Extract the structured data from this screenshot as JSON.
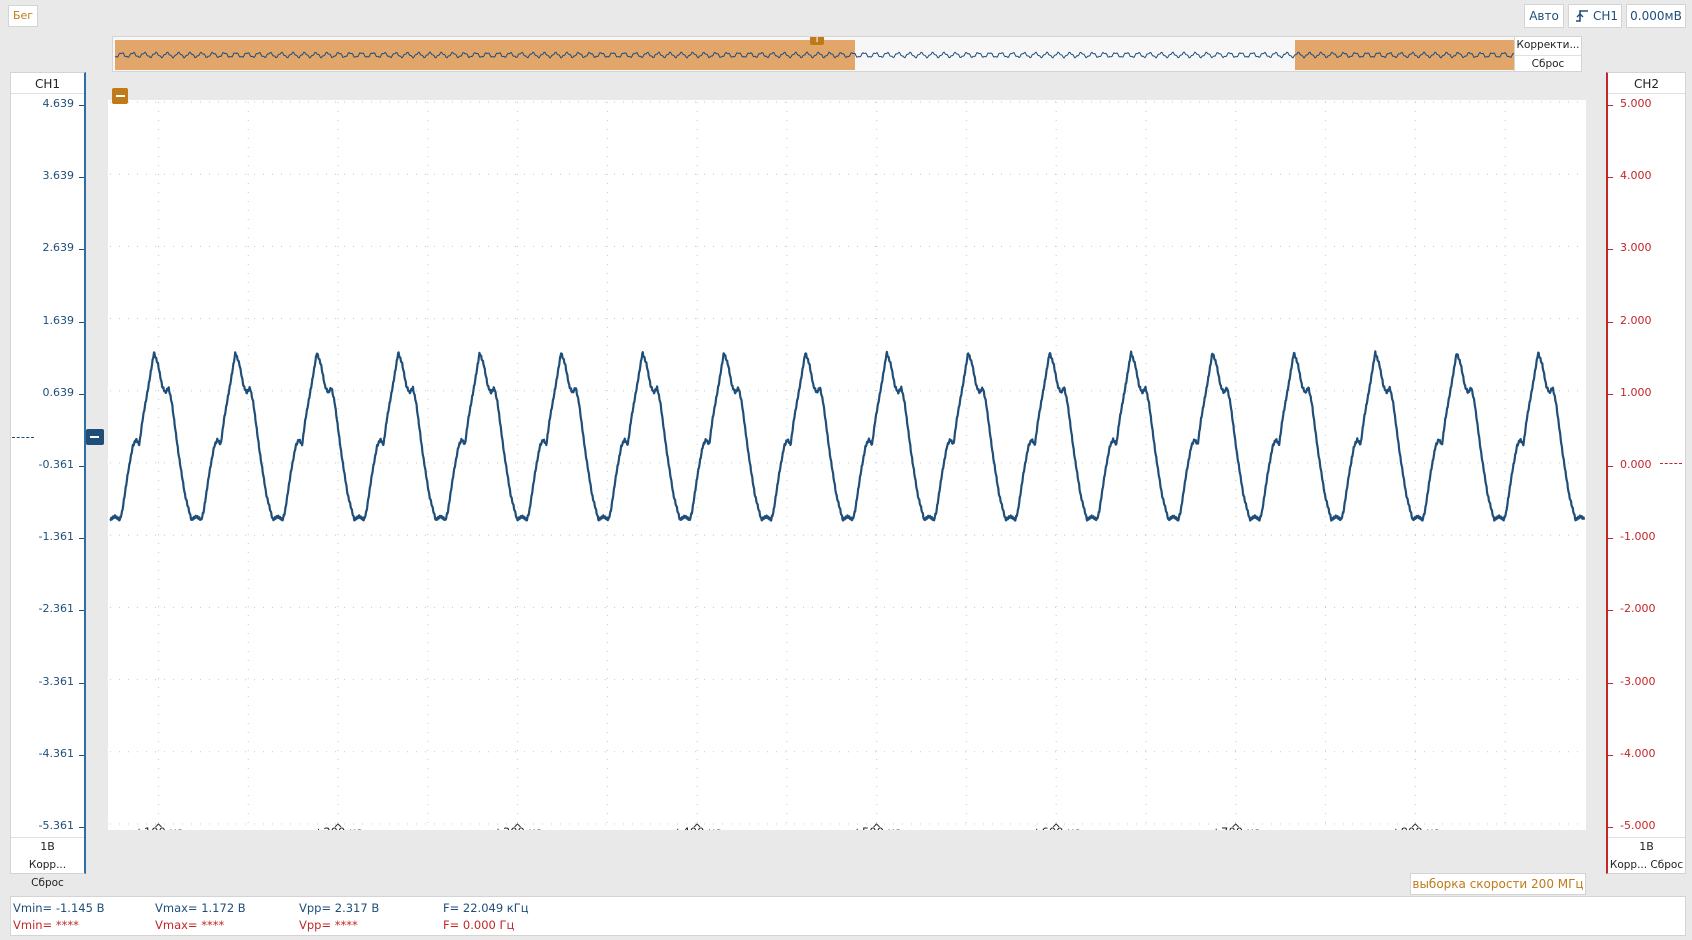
{
  "toolbar": {
    "status": "Бег",
    "trigger_mode": "Авто",
    "trigger_source": "CH1",
    "trigger_level": "0.000мВ"
  },
  "overview": {
    "buttons": [
      "Корректи...",
      "Сброс"
    ],
    "trigger_marker": "T"
  },
  "ch1": {
    "title": "CH1",
    "scale": "1В",
    "buttons": "Корр... Сброс",
    "ticks": [
      "4.639",
      "3.639",
      "2.639",
      "1.639",
      "0.639",
      "-0.361",
      "-1.361",
      "-2.361",
      "-3.361",
      "-4.361",
      "-5.361"
    ],
    "color": "#1f4e79"
  },
  "ch2": {
    "title": "CH2",
    "scale": "1В",
    "buttons": "Корр... Сброс",
    "ticks": [
      "5.000",
      "4.000",
      "3.000",
      "2.000",
      "1.000",
      "0.000",
      "-1.000",
      "-2.000",
      "-3.000",
      "-4.000",
      "-5.000"
    ],
    "color": "#c0282a"
  },
  "time_axis": {
    "ticks": [
      "+100 us",
      "+200 us",
      "+300 us",
      "+400 us",
      "+500 us",
      "+600 us",
      "+700 us",
      "+800 us"
    ]
  },
  "sample_rate": "выборка скорости 200 МГц",
  "measurements": {
    "ch1": {
      "vmin": "Vmin= -1.145 В",
      "vmax": "Vmax= 1.172 В",
      "vpp": "Vpp= 2.317 В",
      "freq": "F= 22.049 кГц"
    },
    "ch2": {
      "vmin": "Vmin= ****",
      "vmax": "Vmax= ****",
      "vpp": "Vpp= ****",
      "freq": "F= 0.000 Гц"
    }
  },
  "chart_data": {
    "type": "line",
    "series": [
      {
        "name": "CH1",
        "period_us": 45.35,
        "vmin": -1.145,
        "vmax": 1.172
      }
    ],
    "x_range_us": [
      73,
      894
    ],
    "ch1_ylim": [
      -5.361,
      4.639
    ],
    "ch2_ylim": [
      -5.0,
      5.0
    ],
    "grid": true
  }
}
